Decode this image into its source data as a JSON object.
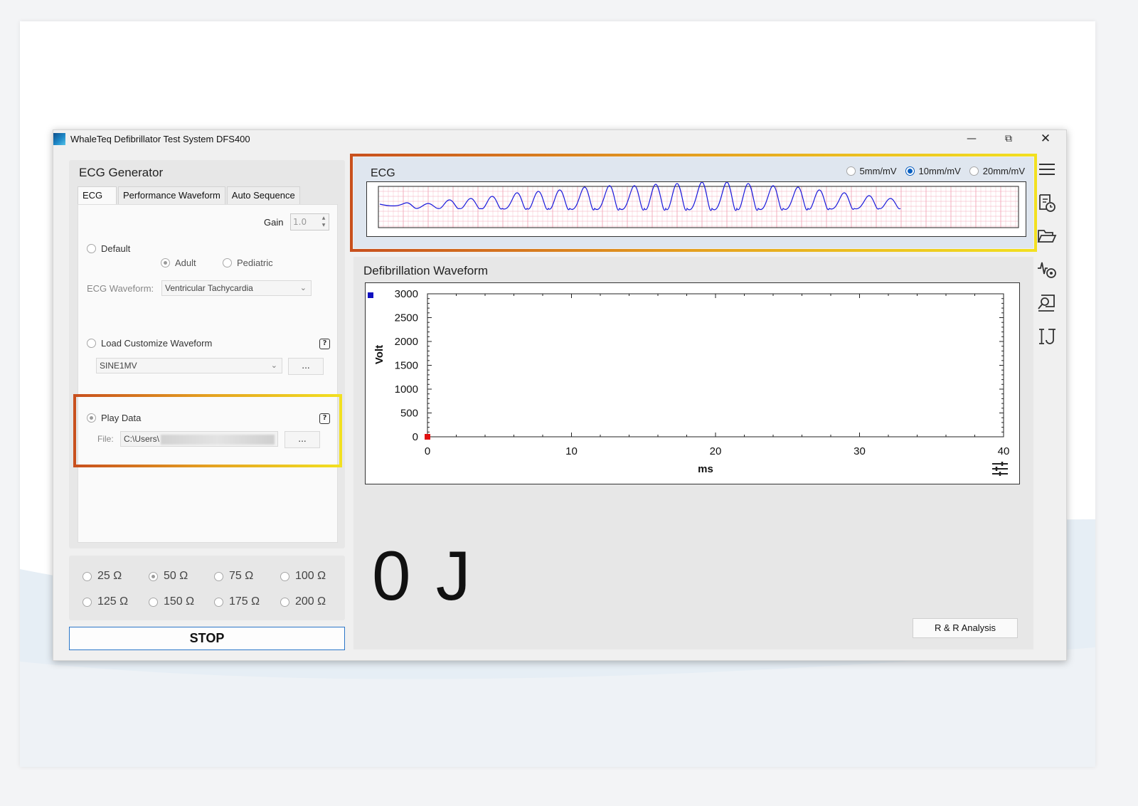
{
  "window": {
    "title": "WhaleTeq Defibrillator Test System DFS400",
    "minimize_glyph": "—",
    "maximize_glyph": "⧉",
    "close_glyph": "✕"
  },
  "ecg_generator": {
    "title": "ECG Generator",
    "tabs": [
      "ECG",
      "Performance Waveform",
      "Auto Sequence"
    ],
    "active_tab": "ECG",
    "gain": {
      "label": "Gain",
      "value": "1.0"
    },
    "default_option": {
      "label": "Default",
      "selected": false,
      "adult_label": "Adult",
      "pediatric_label": "Pediatric",
      "patient_selected": "Adult"
    },
    "ecg_waveform": {
      "label": "ECG Waveform:",
      "value": "Ventricular Tachycardia"
    },
    "load_customize": {
      "label": "Load Customize Waveform",
      "selected": false,
      "file_value": "SINE1MV",
      "browse_label": "..."
    },
    "play_data": {
      "label": "Play Data",
      "selected": true,
      "file_label": "File:",
      "file_value": "C:\\Users\\",
      "browse_label": "..."
    },
    "help_glyph": "?"
  },
  "impedance": {
    "options": [
      "25 Ω",
      "50 Ω",
      "75 Ω",
      "100 Ω",
      "125 Ω",
      "150 Ω",
      "175 Ω",
      "200 Ω"
    ],
    "selected": "50 Ω"
  },
  "stop_button": {
    "label": "STOP"
  },
  "ecg_display": {
    "title": "ECG",
    "scales": [
      "5mm/mV",
      "10mm/mV",
      "20mm/mV"
    ],
    "selected_scale": "10mm/mV",
    "grid_color": "#f2a7b8",
    "trace_color": "#1a1adb"
  },
  "defibrillation": {
    "title": "Defibrillation Waveform",
    "energy_value": "0",
    "energy_unit": "J",
    "rr_button": "R & R Analysis"
  },
  "chart_data": {
    "type": "line",
    "title": "",
    "xlabel": "ms",
    "ylabel": "Volt",
    "xlim": [
      0,
      40
    ],
    "ylim": [
      0,
      3000
    ],
    "x_ticks": [
      0,
      10,
      20,
      30,
      40
    ],
    "y_ticks": [
      0,
      500,
      1000,
      1500,
      2000,
      2500,
      3000
    ],
    "series": [
      {
        "x": [
          0
        ],
        "y": [
          0
        ],
        "color": "#e01010"
      }
    ],
    "legend_marker_color": "#1010c0",
    "grid": false
  },
  "toolbar": {
    "icons": [
      "menu-icon",
      "report-clock-icon",
      "folder-open-icon",
      "waveform-settings-icon",
      "report-search-icon",
      "calibration-icon"
    ]
  },
  "accent": {
    "highlight_start": "#c8501e",
    "highlight_end": "#f2e020",
    "brand_blue": "#0a5fc0"
  }
}
